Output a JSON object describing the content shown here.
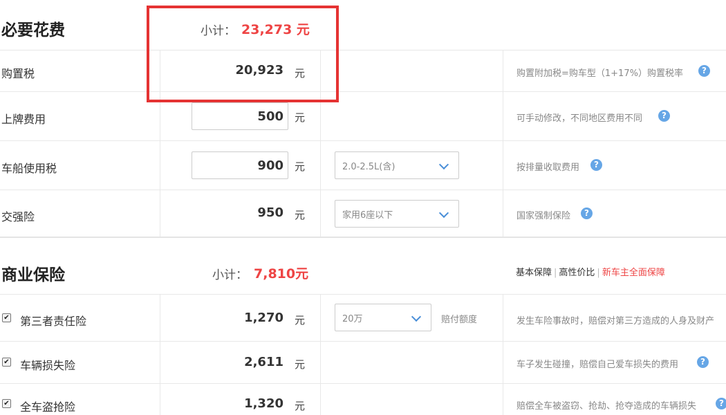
{
  "required": {
    "title": "必要花费",
    "subtotal_label": "小计：",
    "subtotal_value": "23,273 元",
    "rows": [
      {
        "label": "购置税",
        "value": "20,923",
        "unit": "元",
        "note": "购置附加税=购车型（1+17%）购置税率",
        "help": "?"
      },
      {
        "label": "上牌费用",
        "value": "500",
        "unit": "元",
        "note": "可手动修改，不同地区费用不同",
        "help": "?"
      },
      {
        "label": "车船使用税",
        "value": "900",
        "unit": "元",
        "select": "2.0-2.5L(含)",
        "note": "按排量收取费用",
        "help": "?"
      },
      {
        "label": "交强险",
        "value": "950",
        "unit": "元",
        "select": "家用6座以下",
        "note": "国家强制保险",
        "help": "?"
      }
    ]
  },
  "commercial": {
    "title": "商业保险",
    "subtotal_label": "小计：",
    "subtotal_value": "7,810元",
    "links": {
      "basic": "基本保障",
      "sep": "|",
      "value": "高性价比",
      "full": "新车主全面保障"
    },
    "rows": [
      {
        "label": "第三者责任险",
        "value": "1,270",
        "unit": "元",
        "select": "20万",
        "extra": "赔付额度",
        "note": "发生车险事故时，赔偿对第三方造成的人身及财产",
        "checked": true
      },
      {
        "label": "车辆损失险",
        "value": "2,611",
        "unit": "元",
        "note": "车子发生碰撞，赔偿自己爱车损失的费用",
        "help": "?",
        "checked": true
      },
      {
        "label": "全车盗抢险",
        "value": "1,320",
        "unit": "元",
        "note": "赔偿全车被盗窃、抢劫、抢夺造成的车辆损失",
        "help": "?",
        "checked": true
      }
    ]
  },
  "checkbox_mark": "✔",
  "colors": {
    "accent_red": "#ee4444",
    "help_blue": "#66a6e6",
    "highlight_border": "#e53333"
  }
}
